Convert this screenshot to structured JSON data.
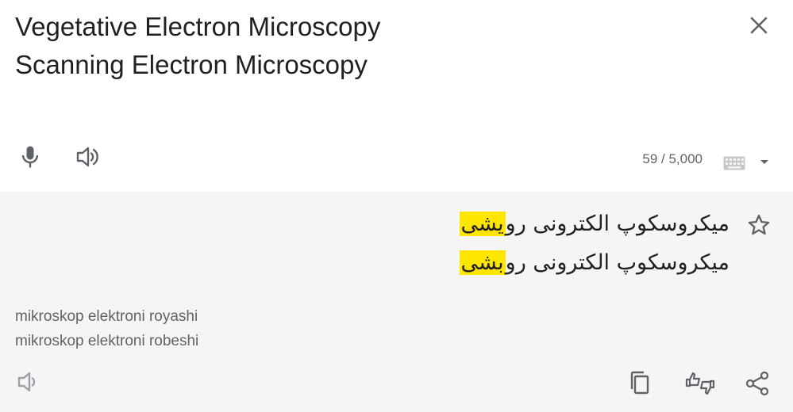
{
  "source": {
    "lines": [
      "Vegetative Electron Microscopy",
      "Scanning Electron Microscopy"
    ],
    "char_count": "59 / 5,000"
  },
  "target": {
    "lines": [
      {
        "before": "میکروسکوپ الکترونی رو",
        "highlight": "یشی"
      },
      {
        "before": "میکروسکوپ الکترونی رو",
        "highlight": "بشی"
      }
    ],
    "transliteration": [
      "mikroskop elektroni royashi",
      "mikroskop elektroni robeshi"
    ]
  },
  "icons": {
    "close": "close-icon",
    "mic": "microphone-icon",
    "listen_source": "speaker-icon",
    "keyboard": "keyboard-icon",
    "dropdown": "chevron-down-icon",
    "star": "star-icon",
    "listen_target": "speaker-icon",
    "copy": "copy-icon",
    "rate": "thumbs-up-down-icon",
    "share": "share-icon"
  },
  "colors": {
    "highlight": "#ffe600",
    "target_background": "#f5f5f5",
    "icon": "#5f6368",
    "disabled_icon": "#9aa0a6"
  }
}
